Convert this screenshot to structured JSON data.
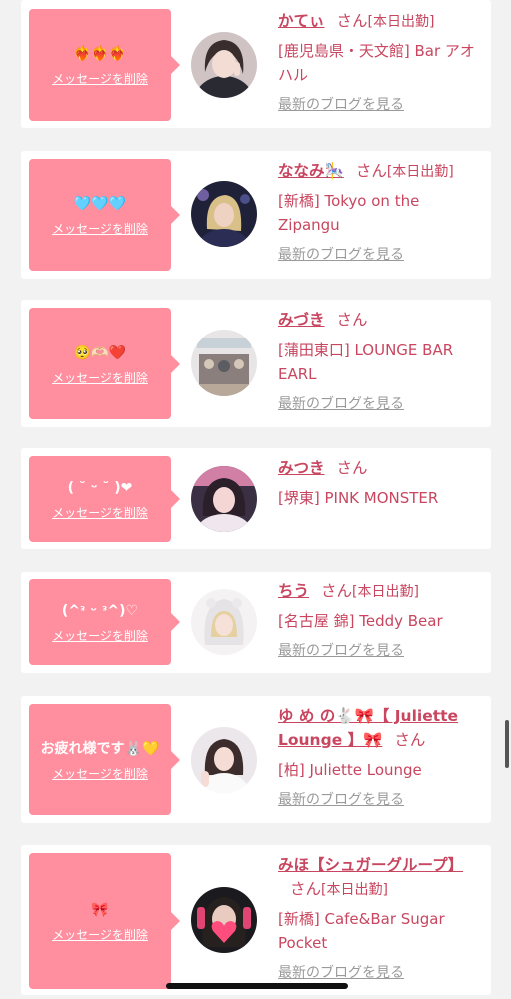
{
  "colors": {
    "bubble": "#ff8f9f",
    "name": "#c8465f",
    "background": "#f2f2f2",
    "blog": "#9a9a9a"
  },
  "delete_label": "メッセージを削除",
  "blog_label": "最新のブログを見る",
  "san_label": "さん",
  "items": [
    {
      "message": "❤️‍🔥❤️‍🔥❤️‍🔥",
      "name": "かてぃ",
      "tag": "[本日出勤]",
      "shop": "[鹿児島県・天文館] Bar アオハル",
      "avatar": "girl-peace-sign"
    },
    {
      "message": "🩵🩵🩵",
      "name": "ななみ🎠",
      "tag": "[本日出勤]",
      "shop": "[新橋] Tokyo on the Zipangu",
      "avatar": "blonde-girl"
    },
    {
      "message": "🥺🫶🏻❤️",
      "name": "みづき",
      "tag": "",
      "shop": "[蒲田東口] LOUNGE BAR EARL",
      "avatar": "bar-interior"
    },
    {
      "message": "( ˘ ᵕ ˘ )❤",
      "name": "みつき",
      "tag": "",
      "shop": "[堺東] PINK MONSTER",
      "avatar": "girl-selfie"
    },
    {
      "message": "(^ᵌ ᵕ ᵌ^)♡",
      "name": "ちう",
      "tag": "[本日出勤]",
      "shop": "[名古屋 錦] Teddy Bear",
      "avatar": "white-hood-girl"
    },
    {
      "message": "お疲れ様です🐰💛",
      "name": "ゆ め の🐇🎀【 Juliette Lounge 】🎀",
      "tag": "",
      "shop": "[柏] Juliette Lounge",
      "avatar": "white-dress-girl"
    },
    {
      "message": "🎀",
      "name": "みほ【シュガーグループ】",
      "tag": "[本日出勤]",
      "shop": "[新橋] Cafe&Bar Sugar Pocket",
      "avatar": "girl-heart-sticker"
    }
  ]
}
